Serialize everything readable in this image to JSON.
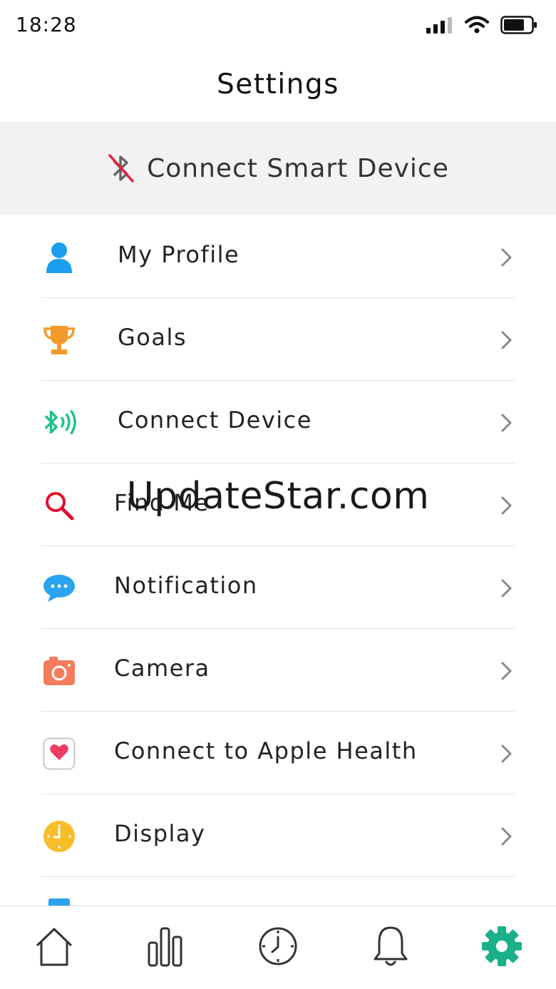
{
  "status_bar": {
    "time": "18:28"
  },
  "nav": {
    "title": "Settings"
  },
  "connect_banner": {
    "label": "Connect Smart Device",
    "icon": "bluetooth-disabled-icon"
  },
  "settings": {
    "items": [
      {
        "label": "My Profile",
        "icon": "person-icon",
        "color": "#1a9ef0"
      },
      {
        "label": "Goals",
        "icon": "trophy-icon",
        "color": "#f39a2b"
      },
      {
        "label": "Connect Device",
        "icon": "bluetooth-signal-icon",
        "color": "#1cc08a"
      },
      {
        "label": "Find Me",
        "icon": "search-icon",
        "color": "#e0102a"
      },
      {
        "label": "Notification",
        "icon": "chat-bubble-icon",
        "color": "#2aa3f0"
      },
      {
        "label": "Camera",
        "icon": "camera-icon",
        "color": "#f57c5b"
      },
      {
        "label": "Connect to Apple Health",
        "icon": "health-heart-icon",
        "color": "#f03a5f"
      },
      {
        "label": "Display",
        "icon": "clock-icon",
        "color": "#f7be2a"
      }
    ]
  },
  "watermark": "UpdateStar.com",
  "tab_bar": {
    "tabs": [
      {
        "icon": "home-icon",
        "active": false
      },
      {
        "icon": "bar-chart-icon",
        "active": false
      },
      {
        "icon": "clock-icon",
        "active": false
      },
      {
        "icon": "bell-icon",
        "active": false
      },
      {
        "icon": "gear-icon",
        "active": true
      }
    ],
    "active_color": "#1cb08a"
  }
}
